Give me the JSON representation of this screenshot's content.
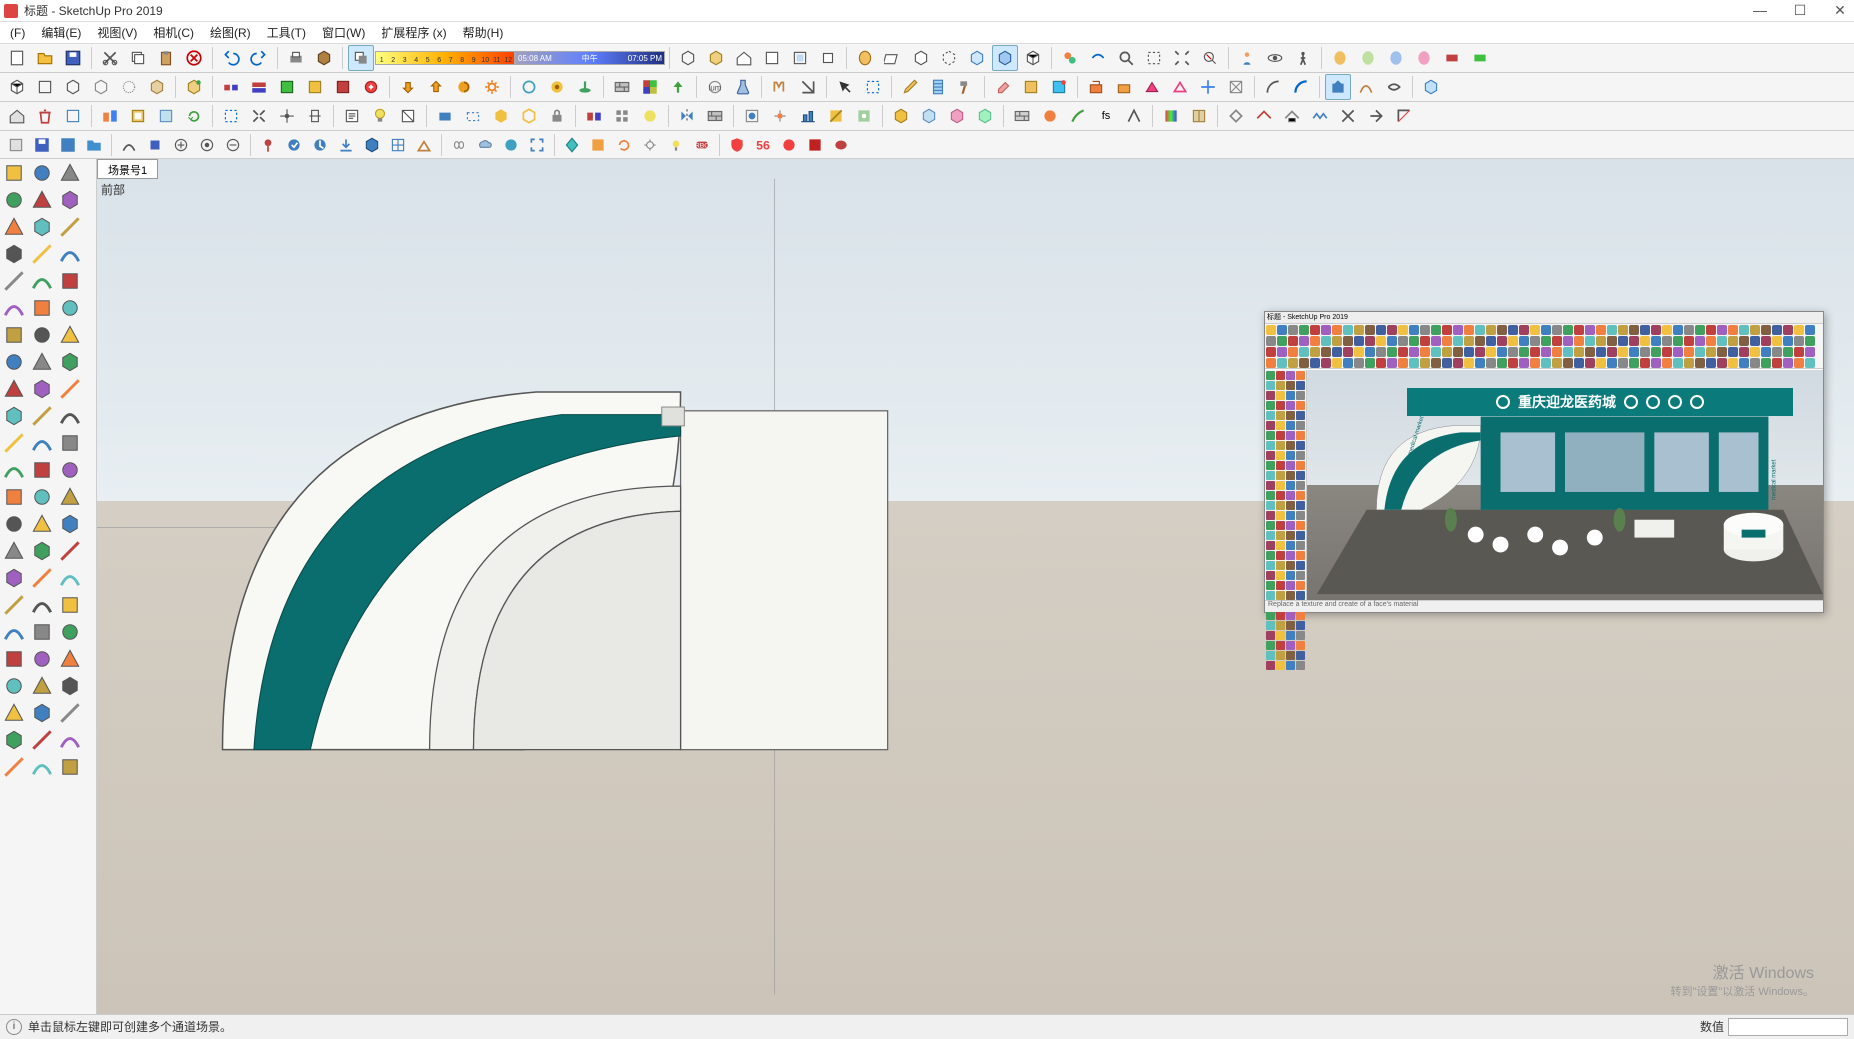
{
  "title": "标题 - SketchUp Pro 2019",
  "menus": [
    "(F)",
    "编辑(E)",
    "视图(V)",
    "相机(C)",
    "绘图(R)",
    "工具(T)",
    "窗口(W)",
    "扩展程序 (x)",
    "帮助(H)"
  ],
  "gradient_ticks": [
    "1",
    "2",
    "3",
    "4",
    "5",
    "6",
    "7",
    "8",
    "9",
    "10",
    "11",
    "12"
  ],
  "time_left": "05:08 AM",
  "time_mid": "中午",
  "time_right": "07:05 PM",
  "scene_tab": "场景号1",
  "view_label": "前部",
  "status_hint": "单击鼠标左键即可创建多个通道场景。",
  "value_label": "数值",
  "watermark_title": "激活 Windows",
  "watermark_sub": "转到\"设置\"以激活 Windows。",
  "ref_title": "标题 - SketchUp Pro 2019",
  "ref_booth_title": "重庆迎龙医药城",
  "ref_side_text_left": "medical market",
  "ref_side_text_right": "medical market",
  "ref_status": "Replace a texture and create of a face's material"
}
